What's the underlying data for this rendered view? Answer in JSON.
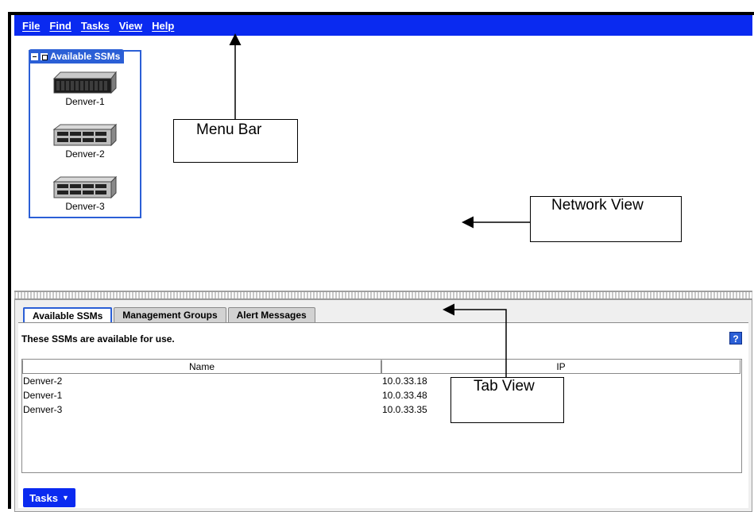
{
  "menu": [
    "File",
    "Find",
    "Tasks",
    "View",
    "Help"
  ],
  "network_view": {
    "group_title": "Available SSMs",
    "devices": [
      {
        "label": "Denver-1",
        "icon": "server-rack-icon"
      },
      {
        "label": "Denver-2",
        "icon": "server-rack-icon"
      },
      {
        "label": "Denver-3",
        "icon": "server-rack-icon"
      }
    ]
  },
  "annotations": {
    "menu_bar": "Menu Bar",
    "network_view": "Network View",
    "tab_view": "Tab View"
  },
  "tabs": [
    "Available SSMs",
    "Management Groups",
    "Alert Messages"
  ],
  "tab_content": {
    "description": "These SSMs are available for use.",
    "help_icon": "?",
    "columns": [
      "Name",
      "IP"
    ],
    "rows": [
      {
        "name": "Denver-2",
        "ip": "10.0.33.18"
      },
      {
        "name": "Denver-1",
        "ip": "10.0.33.48"
      },
      {
        "name": "Denver-3",
        "ip": "10.0.33.35"
      }
    ],
    "tasks_button": "Tasks"
  },
  "colors": {
    "menubar": "#0a2af0",
    "accent": "#2b5fd6"
  }
}
